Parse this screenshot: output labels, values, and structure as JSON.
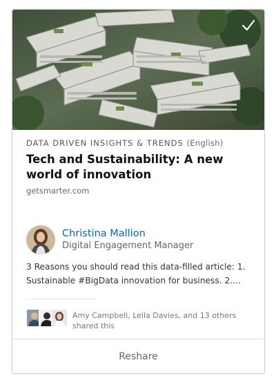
{
  "article": {
    "source_label": "DATA DRIVEN INSIGHTS & TRENDS",
    "language": "(English)",
    "title": "Tech and Sustainability: A new world of innovation",
    "domain": "getsmarter.com"
  },
  "author": {
    "name": "Christina Mallion",
    "role": "Digital Engagement Manager"
  },
  "post": {
    "text": "3 Reasons you should read this data-filled article: 1. Sustainable #BigData innovation for business. 2...."
  },
  "social": {
    "shared_text": "Amy Campbell, Leila Davies, and 13 others shared this"
  },
  "actions": {
    "reshare_label": "Reshare"
  },
  "colors": {
    "accent": "#0a66c2",
    "border": "#d3d3d3"
  },
  "icons": {
    "selected": "checkmark-icon"
  }
}
